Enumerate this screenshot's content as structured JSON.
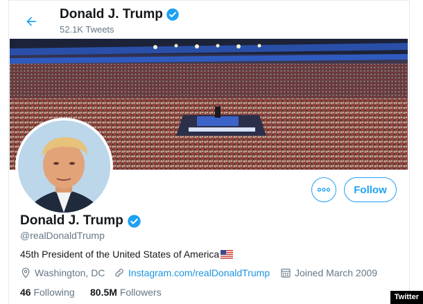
{
  "header": {
    "name": "Donald J. Trump",
    "tweet_count": "52.1K Tweets"
  },
  "profile": {
    "name": "Donald J. Trump",
    "handle": "@realDonaldTrump",
    "bio": "45th President of the United States of America",
    "location": "Washington, DC",
    "link": "Instagram.com/realDonaldTrump",
    "joined": "Joined March 2009",
    "following_count": "46",
    "following_label": "Following",
    "followers_count": "80.5M",
    "followers_label": "Followers"
  },
  "actions": {
    "follow_label": "Follow"
  },
  "credit": "Twitter",
  "colors": {
    "accent": "#1da1f2",
    "link": "#1b95e0",
    "text_secondary": "#657786"
  },
  "icons": [
    "back-arrow-icon",
    "verified-badge-icon",
    "more-options-icon",
    "location-pin-icon",
    "link-icon",
    "calendar-icon",
    "us-flag-icon"
  ]
}
